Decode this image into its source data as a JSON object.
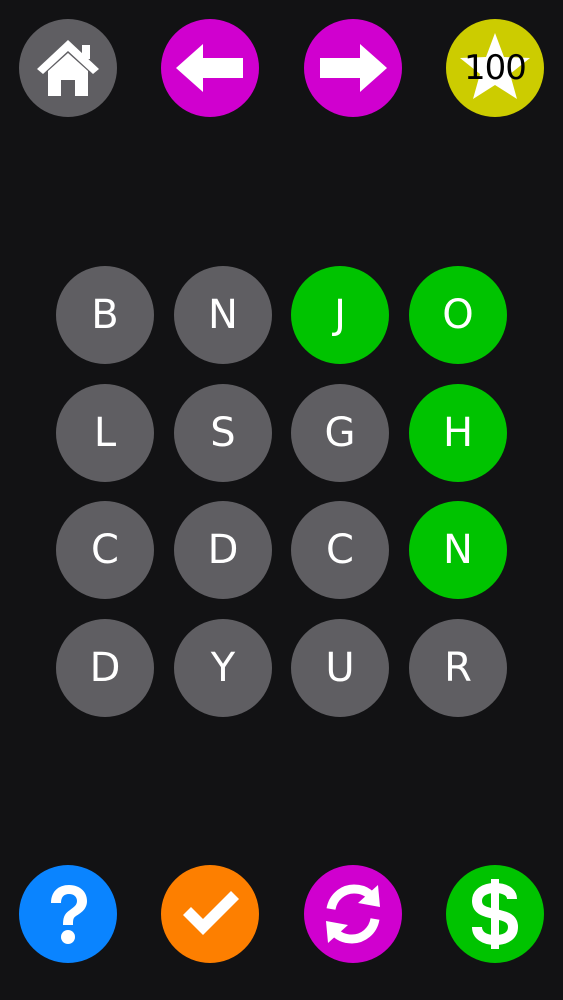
{
  "colors": {
    "background": "#121214",
    "tile_idle": "#5f5e62",
    "tile_selected": "#00c300",
    "home": "#5f5e62",
    "nav": "#d000cf",
    "coins": "#cccc00",
    "help": "#0a84ff",
    "check": "#fd7f00",
    "shuffle": "#d000cf",
    "buy": "#00c300"
  },
  "header": {
    "home_icon": "house-icon",
    "prev_icon": "arrow-left-icon",
    "next_icon": "arrow-right-icon",
    "coins_icon": "star-icon",
    "coins_value": "100"
  },
  "footer": {
    "help_icon": "question-mark-icon",
    "check_icon": "checkmark-icon",
    "shuffle_icon": "refresh-icon",
    "buy_icon": "dollar-icon"
  },
  "board": {
    "rows": [
      [
        {
          "letter": "B",
          "selected": false
        },
        {
          "letter": "N",
          "selected": false
        },
        {
          "letter": "J",
          "selected": true
        },
        {
          "letter": "O",
          "selected": true
        }
      ],
      [
        {
          "letter": "L",
          "selected": false
        },
        {
          "letter": "S",
          "selected": false
        },
        {
          "letter": "G",
          "selected": false
        },
        {
          "letter": "H",
          "selected": true
        }
      ],
      [
        {
          "letter": "C",
          "selected": false
        },
        {
          "letter": "D",
          "selected": false
        },
        {
          "letter": "C",
          "selected": false
        },
        {
          "letter": "N",
          "selected": true
        }
      ],
      [
        {
          "letter": "D",
          "selected": false
        },
        {
          "letter": "Y",
          "selected": false
        },
        {
          "letter": "U",
          "selected": false
        },
        {
          "letter": "R",
          "selected": false
        }
      ]
    ]
  }
}
